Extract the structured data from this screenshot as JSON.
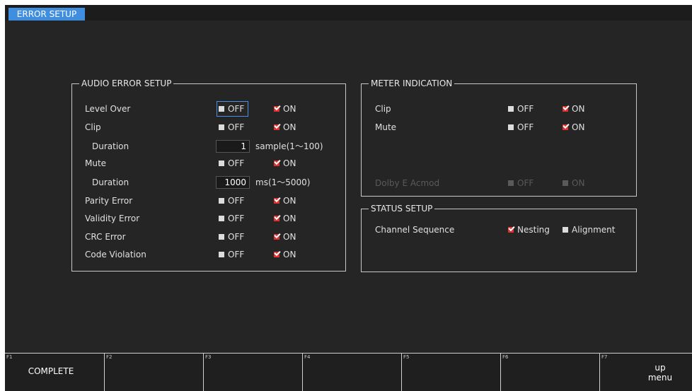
{
  "tab": {
    "label": "ERROR SETUP"
  },
  "audio_error": {
    "title": "AUDIO ERROR SETUP",
    "off": "OFF",
    "on": "ON",
    "level_over": "Level Over",
    "clip": "Clip",
    "clip_duration_label": "Duration",
    "clip_duration_value": "1",
    "clip_duration_unit": "sample(1〜100)",
    "mute": "Mute",
    "mute_duration_label": "Duration",
    "mute_duration_value": "1000",
    "mute_duration_unit": "ms(1〜5000)",
    "parity_error": "Parity Error",
    "validity_error": "Validity Error",
    "crc_error": "CRC Error",
    "code_violation": "Code Violation"
  },
  "meter_indication": {
    "title": "METER INDICATION",
    "off": "OFF",
    "on": "ON",
    "clip": "Clip",
    "mute": "Mute",
    "dolby": "Dolby E Acmod"
  },
  "status_setup": {
    "title": "STATUS SETUP",
    "channel_sequence": "Channel Sequence",
    "nesting": "Nesting",
    "alignment": "Alignment"
  },
  "function_keys": {
    "f1": {
      "num": "F1",
      "label": "COMPLETE"
    },
    "f2": {
      "num": "F2"
    },
    "f3": {
      "num": "F3"
    },
    "f4": {
      "num": "F4"
    },
    "f5": {
      "num": "F5"
    },
    "f6": {
      "num": "F6"
    },
    "f7": {
      "num": "F7",
      "line1": "up",
      "line2": "menu"
    }
  },
  "colors": {
    "accent": "#3f8ee0",
    "checked": "#e03030",
    "background": "#252525"
  }
}
